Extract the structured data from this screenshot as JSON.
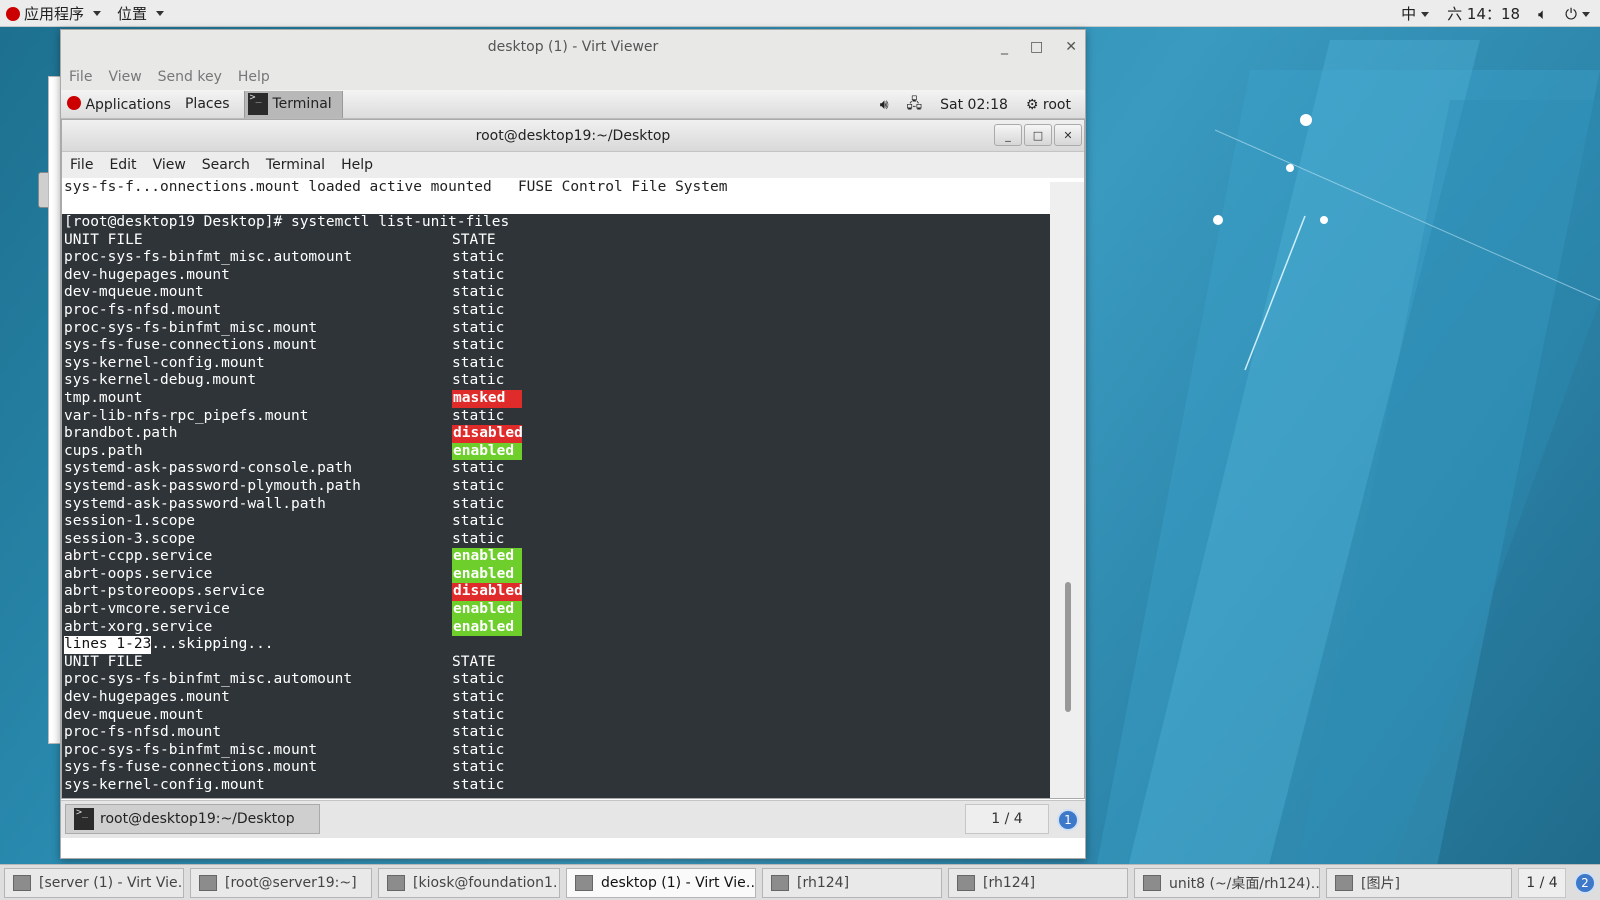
{
  "host_top": {
    "apps_label": "应用程序",
    "places_label": "位置",
    "input_method": "中",
    "clock": "六 14：18"
  },
  "virt_viewer": {
    "title": "desktop (1) - Virt Viewer",
    "menu": [
      "File",
      "View",
      "Send key",
      "Help"
    ]
  },
  "guest_panel": {
    "applications": "Applications",
    "places": "Places",
    "terminal": "Terminal",
    "clock": "Sat 02:18",
    "user": "root"
  },
  "terminal": {
    "title": "root@desktop19:~/Desktop",
    "menu": [
      "File",
      "Edit",
      "View",
      "Search",
      "Terminal",
      "Help"
    ],
    "previous_line": "sys-fs-f...onnections.mount loaded active mounted   FUSE Control File System",
    "command": "[root@desktop19 Desktop]# systemctl list-unit-files",
    "rows": [
      {
        "name": "UNIT FILE",
        "state": "STATE",
        "style": "plain"
      },
      {
        "name": "proc-sys-fs-binfmt_misc.automount",
        "state": "static",
        "style": "plain"
      },
      {
        "name": "dev-hugepages.mount",
        "state": "static",
        "style": "plain"
      },
      {
        "name": "dev-mqueue.mount",
        "state": "static",
        "style": "plain"
      },
      {
        "name": "proc-fs-nfsd.mount",
        "state": "static",
        "style": "plain"
      },
      {
        "name": "proc-sys-fs-binfmt_misc.mount",
        "state": "static",
        "style": "plain"
      },
      {
        "name": "sys-fs-fuse-connections.mount",
        "state": "static",
        "style": "plain"
      },
      {
        "name": "sys-kernel-config.mount",
        "state": "static",
        "style": "plain"
      },
      {
        "name": "sys-kernel-debug.mount",
        "state": "static",
        "style": "plain"
      },
      {
        "name": "tmp.mount",
        "state": "masked",
        "style": "masked"
      },
      {
        "name": "var-lib-nfs-rpc_pipefs.mount",
        "state": "static",
        "style": "plain"
      },
      {
        "name": "brandbot.path",
        "state": "disabled",
        "style": "disabled"
      },
      {
        "name": "cups.path",
        "state": "enabled",
        "style": "enabled"
      },
      {
        "name": "systemd-ask-password-console.path",
        "state": "static",
        "style": "plain"
      },
      {
        "name": "systemd-ask-password-plymouth.path",
        "state": "static",
        "style": "plain"
      },
      {
        "name": "systemd-ask-password-wall.path",
        "state": "static",
        "style": "plain"
      },
      {
        "name": "session-1.scope",
        "state": "static",
        "style": "plain"
      },
      {
        "name": "session-3.scope",
        "state": "static",
        "style": "plain"
      },
      {
        "name": "abrt-ccpp.service",
        "state": "enabled",
        "style": "enabled"
      },
      {
        "name": "abrt-oops.service",
        "state": "enabled",
        "style": "enabled"
      },
      {
        "name": "abrt-pstoreoops.service",
        "state": "disabled",
        "style": "disabled"
      },
      {
        "name": "abrt-vmcore.service",
        "state": "enabled",
        "style": "enabled"
      },
      {
        "name": "abrt-xorg.service",
        "state": "enabled",
        "style": "enabled"
      }
    ],
    "pager_status": "lines 1-23",
    "pager_suffix": "...skipping...",
    "rows2": [
      {
        "name": "UNIT FILE",
        "state": "STATE"
      },
      {
        "name": "proc-sys-fs-binfmt_misc.automount",
        "state": "static"
      },
      {
        "name": "dev-hugepages.mount",
        "state": "static"
      },
      {
        "name": "dev-mqueue.mount",
        "state": "static"
      },
      {
        "name": "proc-fs-nfsd.mount",
        "state": "static"
      },
      {
        "name": "proc-sys-fs-binfmt_misc.mount",
        "state": "static"
      },
      {
        "name": "sys-fs-fuse-connections.mount",
        "state": "static"
      },
      {
        "name": "sys-kernel-config.mount",
        "state": "static"
      }
    ]
  },
  "guest_bottom": {
    "task": "root@desktop19:~/Desktop",
    "workspace": "1 / 4",
    "notifications": "1"
  },
  "host_taskbar": {
    "tasks": [
      {
        "label": "[server (1) - Virt Vie…",
        "active": false
      },
      {
        "label": "[root@server19:~]",
        "active": false
      },
      {
        "label": "[kiosk@foundation1…",
        "active": false
      },
      {
        "label": "desktop (1) - Virt Vie…",
        "active": true
      },
      {
        "label": "[rh124]",
        "active": false
      },
      {
        "label": "[rh124]",
        "active": false
      },
      {
        "label": "unit8 (~/桌面/rh124)…",
        "active": false
      },
      {
        "label": "[图片]",
        "active": false
      }
    ],
    "workspace": "1 / 4",
    "notifications": "2"
  },
  "colors": {
    "masked": "#e02b2b",
    "disabled": "#e02b2b",
    "enabled": "#6dce2c",
    "terminal_bg": "#2f3438"
  }
}
